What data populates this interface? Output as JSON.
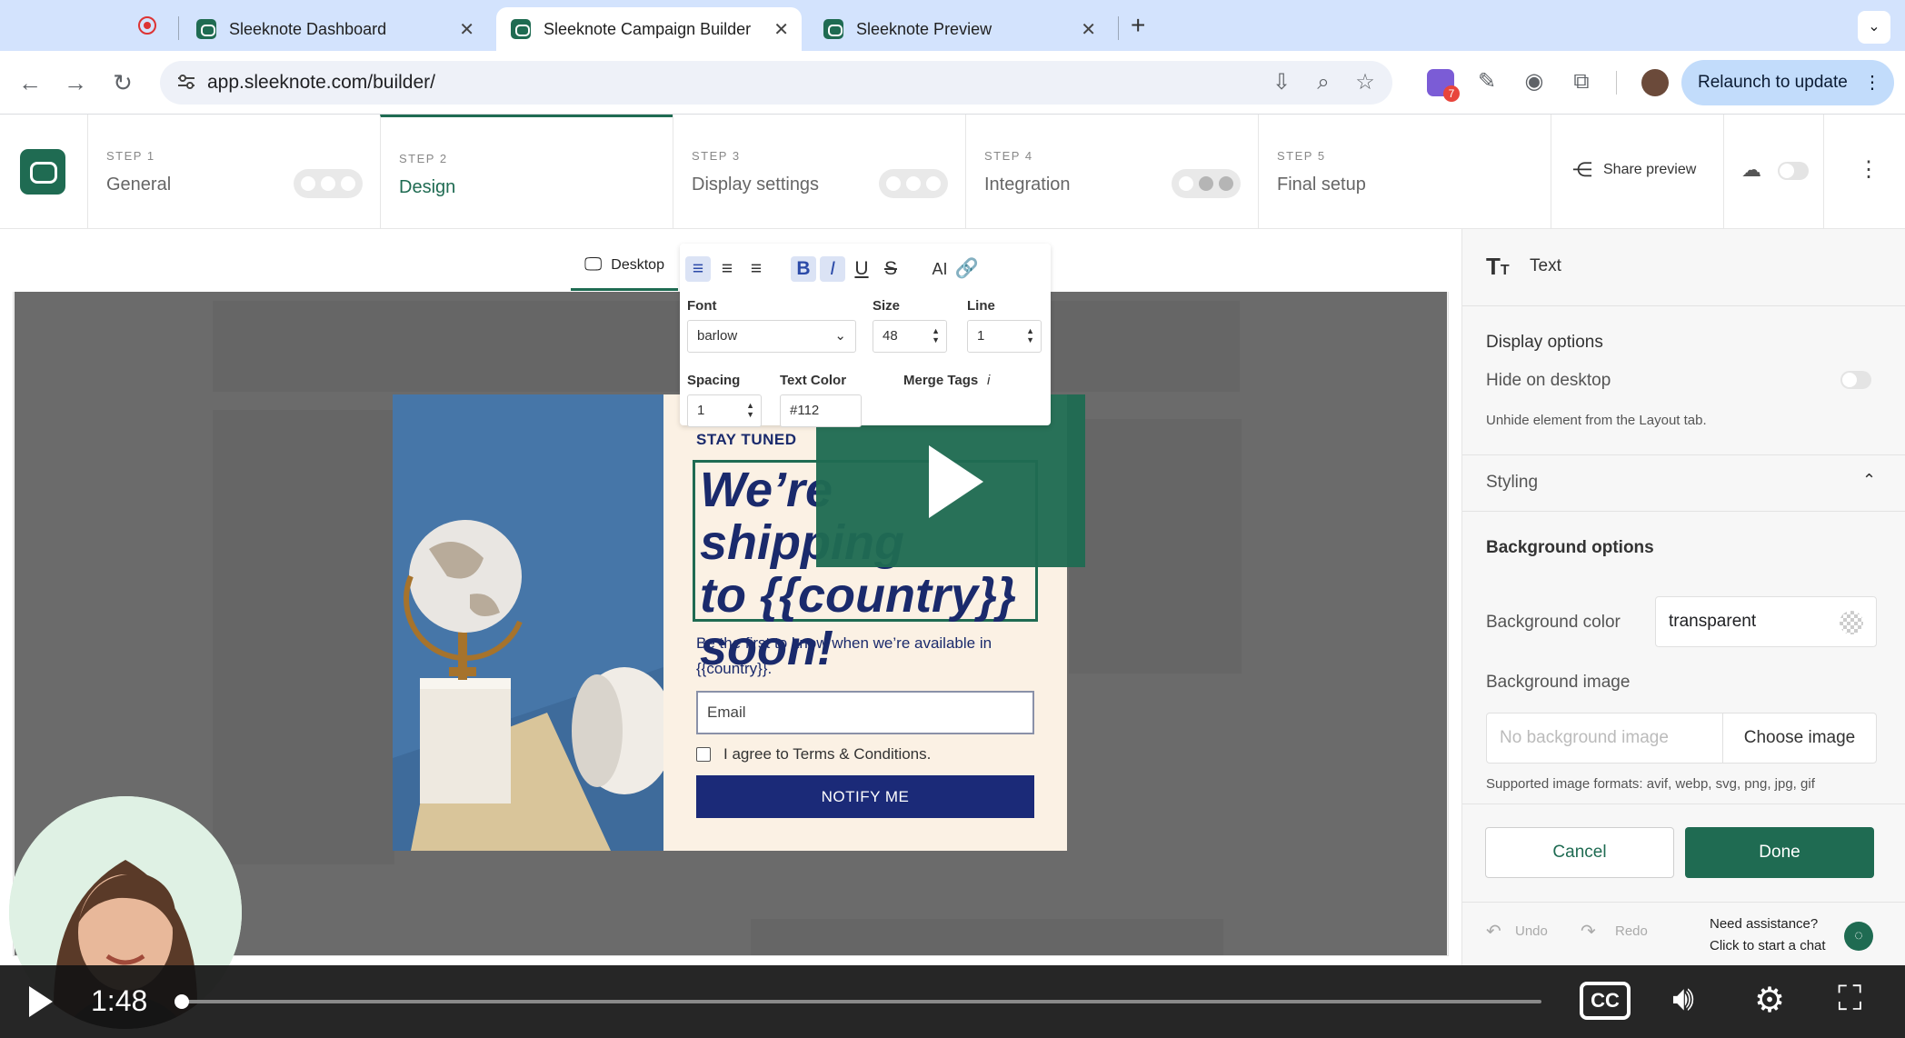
{
  "browser": {
    "tabs": [
      {
        "label": "Sleeknote Dashboard"
      },
      {
        "label": "Sleeknote Campaign Builder"
      },
      {
        "label": "Sleeknote Preview"
      }
    ],
    "url": "app.sleeknote.com/builder/",
    "relaunch_label": "Relaunch to update",
    "extension_badge": "7"
  },
  "steps": [
    {
      "num": "STEP 1",
      "name": "General"
    },
    {
      "num": "STEP 2",
      "name": "Design"
    },
    {
      "num": "STEP 3",
      "name": "Display settings"
    },
    {
      "num": "STEP 4",
      "name": "Integration"
    },
    {
      "num": "STEP 5",
      "name": "Final setup"
    }
  ],
  "header": {
    "share_preview": "Share preview"
  },
  "canvas": {
    "device": "Desktop",
    "toolbar": {
      "font_label": "Font",
      "font_value": "barlow",
      "size_label": "Size",
      "size_value": "48",
      "line_label": "Line",
      "line_value": "1",
      "spacing_label": "Spacing",
      "spacing_value": "1",
      "color_label": "Text Color",
      "color_value": "#112",
      "merge_label": "Merge Tags",
      "merge_info": "i",
      "ai_label": "AI"
    }
  },
  "popup": {
    "kicker": "STAY TUNED",
    "headline_line1": "We’re shipping",
    "headline_line2": "to {{country}}",
    "headline_line3": "soon!",
    "body": "Be the first to know when we’re available in {{country}}.",
    "email_placeholder": "Email",
    "terms": "I agree to Terms & Conditions.",
    "button": "NOTIFY ME"
  },
  "panel": {
    "title": "Text",
    "display_options": "Display options",
    "hide_on_desktop": "Hide on desktop",
    "unhide_hint": "Unhide element from the Layout tab.",
    "styling": "Styling",
    "background_options": "Background options",
    "background_color_label": "Background color",
    "background_color_value": "transparent",
    "background_image_label": "Background image",
    "background_image_placeholder": "No background image",
    "choose_image": "Choose image",
    "formats": "Supported image formats: avif, webp, svg, png, jpg, gif",
    "cancel": "Cancel",
    "done": "Done",
    "undo": "Undo",
    "redo": "Redo",
    "assist_title": "Need assistance?",
    "assist_sub": "Click to start a chat"
  },
  "player": {
    "time": "1:48",
    "progress": 0.0,
    "cc_label": "CC"
  },
  "colors": {
    "brand": "#1f6b52",
    "navy": "#1a2a6c",
    "button": "#1b2a78"
  }
}
